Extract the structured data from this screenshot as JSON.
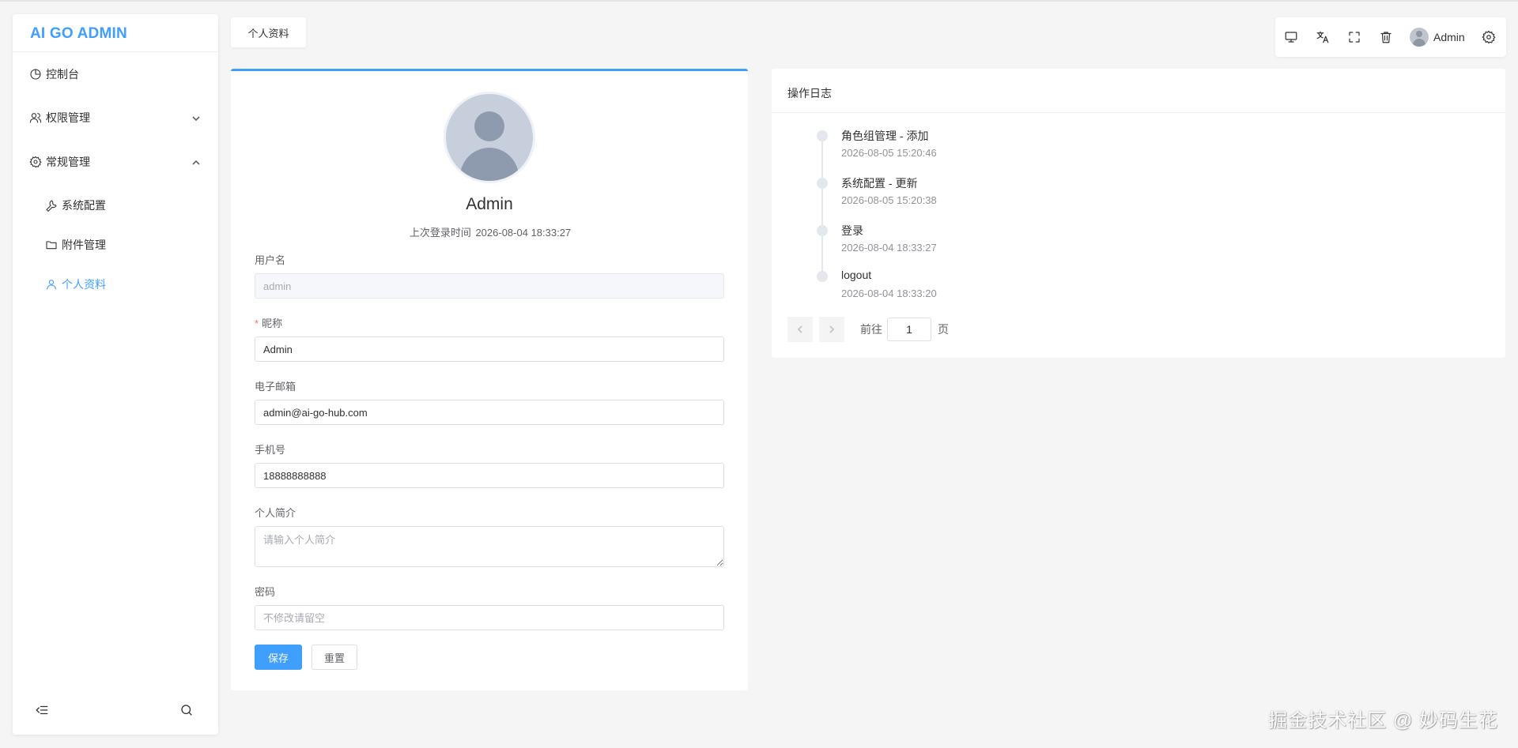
{
  "app": {
    "logo": "AI GO ADMIN",
    "accent_color": "#409eff"
  },
  "sidebar": {
    "items": [
      {
        "label": "控制台",
        "icon": "pie-chart-icon"
      },
      {
        "label": "权限管理",
        "icon": "users-icon",
        "expanded": false
      },
      {
        "label": "常规管理",
        "icon": "gear-icon",
        "expanded": true
      },
      {
        "label": "系统配置",
        "icon": "wrench-icon"
      },
      {
        "label": "附件管理",
        "icon": "folder-icon"
      },
      {
        "label": "个人资料",
        "icon": "user-icon",
        "active": true
      }
    ],
    "bottom": {
      "collapse_icon": "indent-icon",
      "search_icon": "search-icon"
    }
  },
  "tabs": [
    {
      "label": "个人资料",
      "active": true
    }
  ],
  "toolbar": {
    "icons": [
      "monitor-icon",
      "translate-icon",
      "fullscreen-icon",
      "trash-icon",
      "settings-icon"
    ],
    "user_name": "Admin"
  },
  "profile": {
    "name": "Admin",
    "last_login_label": "上次登录时间",
    "last_login_time": "2026-08-04 18:33:27",
    "fields": {
      "username": {
        "label": "用户名",
        "value": "admin"
      },
      "nickname": {
        "label": "昵称",
        "value": "Admin",
        "required": true
      },
      "email": {
        "label": "电子邮箱",
        "value": "admin@ai-go-hub.com"
      },
      "phone": {
        "label": "手机号",
        "value": "18888888888"
      },
      "bio": {
        "label": "个人简介",
        "value": "",
        "placeholder": "请输入个人简介"
      },
      "password": {
        "label": "密码",
        "value": "",
        "placeholder": "不修改请留空"
      }
    },
    "save_label": "保存",
    "reset_label": "重置"
  },
  "logs": {
    "title": "操作日志",
    "items": [
      {
        "title": "角色组管理 - 添加",
        "time": "2026-08-05 15:20:46"
      },
      {
        "title": "系统配置 - 更新",
        "time": "2026-08-05 15:20:38"
      },
      {
        "title": "登录",
        "time": "2026-08-04 18:33:27"
      },
      {
        "title": "logout",
        "time": "2026-08-04 18:33:20"
      }
    ],
    "pager": {
      "goto_label": "前往",
      "page": "1",
      "page_suffix": "页"
    }
  },
  "watermark": "掘金技术社区 @ 妙码生花"
}
